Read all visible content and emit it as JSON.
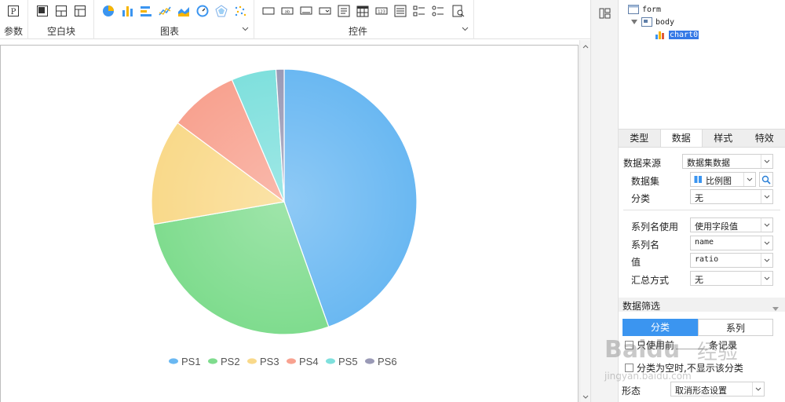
{
  "toolbar": {
    "groups": [
      {
        "label": "参数"
      },
      {
        "label": "空白块"
      },
      {
        "label": "图表"
      },
      {
        "label": "控件"
      }
    ],
    "icons": {
      "param": "P"
    }
  },
  "tree": {
    "form": "form",
    "body": "body",
    "chart": "chart0"
  },
  "tabs": [
    {
      "label": "类型"
    },
    {
      "label": "数据"
    },
    {
      "label": "样式"
    },
    {
      "label": "特效"
    }
  ],
  "props": {
    "data_source_label": "数据来源",
    "data_source_value": "数据集数据",
    "dataset_label": "数据集",
    "dataset_value": "比例图",
    "category_label": "分类",
    "category_value": "无",
    "series_name_use_label": "系列名使用",
    "series_name_use_value": "使用字段值",
    "series_name_label": "系列名",
    "series_name_value": "name",
    "value_label": "值",
    "value_value": "ratio",
    "summary_label": "汇总方式",
    "summary_value": "无",
    "filter_section": "数据筛选",
    "seg_category": "分类",
    "seg_series": "系列",
    "check_only_use": "只使用前",
    "check_only_use_tail": "条记录",
    "check_empty_category": "分类为空时,不显示该分类",
    "shape_label": "形态",
    "shape_value": "取消形态设置"
  },
  "watermark": {
    "brand": "Baidu",
    "brand_cn": "经验",
    "url": "jingyan.baidu.com"
  },
  "colors": {
    "accent": "#3b95f0",
    "selection": "#3478e6"
  },
  "chart_data": {
    "type": "pie",
    "title": "",
    "categories": [
      "PS1",
      "PS2",
      "PS3",
      "PS4",
      "PS5",
      "PS6"
    ],
    "values": [
      45,
      28,
      13,
      8.5,
      5.5,
      1
    ],
    "colors": [
      "#6ab8f2",
      "#7fdc8e",
      "#f9d98a",
      "#f8a290",
      "#7fe0dd",
      "#9a9ab6"
    ],
    "legend": "bottom"
  }
}
